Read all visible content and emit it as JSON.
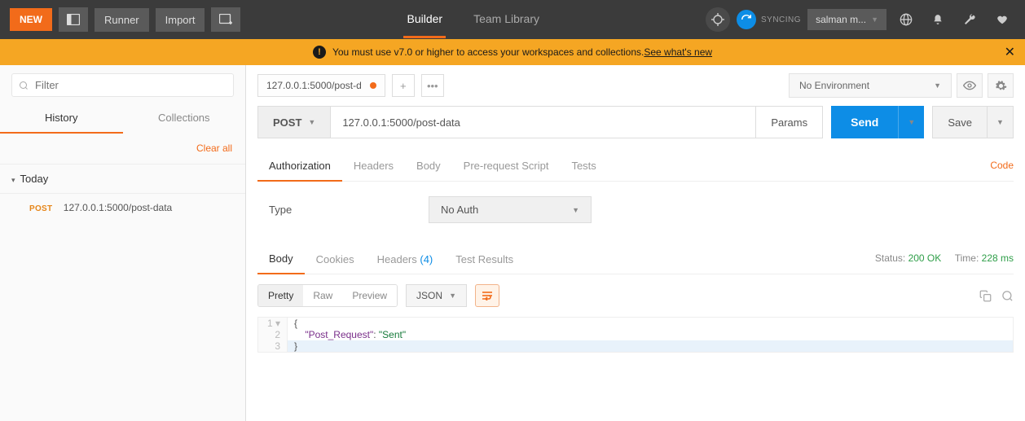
{
  "topbar": {
    "new_label": "NEW",
    "runner_label": "Runner",
    "import_label": "Import",
    "builder_tab": "Builder",
    "team_tab": "Team Library",
    "sync_label": "SYNCING",
    "user_label": "salman m..."
  },
  "warning": {
    "text": "You must use v7.0 or higher to access your workspaces and collections. ",
    "link": "See what's new"
  },
  "sidebar": {
    "filter_placeholder": "Filter",
    "tabs": {
      "history": "History",
      "collections": "Collections"
    },
    "clear_all": "Clear all",
    "group_label": "Today",
    "item": {
      "method": "POST",
      "url": "127.0.0.1:5000/post-data"
    }
  },
  "tabbar": {
    "tab_title": "127.0.0.1:5000/post-d",
    "env_label": "No Environment"
  },
  "request": {
    "method": "POST",
    "url": "127.0.0.1:5000/post-data",
    "params": "Params",
    "send": "Send",
    "save": "Save"
  },
  "req_tabs": {
    "auth": "Authorization",
    "headers": "Headers",
    "body": "Body",
    "pre": "Pre-request Script",
    "tests": "Tests",
    "code": "Code"
  },
  "auth": {
    "type_label": "Type",
    "selected": "No Auth"
  },
  "resp_tabs": {
    "body": "Body",
    "cookies": "Cookies",
    "headers": "Headers",
    "headers_count": "(4)",
    "tests": "Test Results"
  },
  "status": {
    "status_label": "Status:",
    "status_value": "200 OK",
    "time_label": "Time:",
    "time_value": "228 ms"
  },
  "format": {
    "pretty": "Pretty",
    "raw": "Raw",
    "preview": "Preview",
    "lang": "JSON"
  },
  "response_body": {
    "line1_no": "1",
    "line1": "{",
    "line2_no": "2",
    "line2_key": "\"Post_Request\"",
    "line2_sep": ": ",
    "line2_val": "\"Sent\"",
    "line3_no": "3",
    "line3": "}"
  }
}
